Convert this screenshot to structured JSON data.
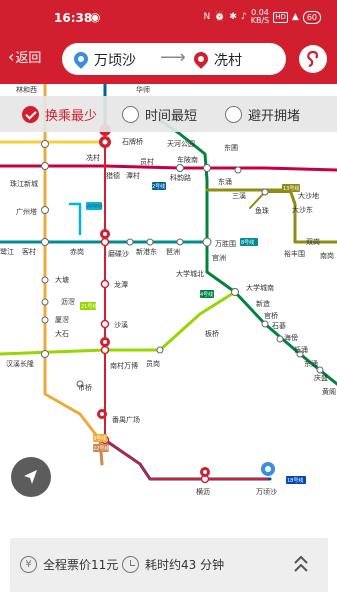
{
  "status_bar": {
    "time": "16:38",
    "network_speed": "0.04",
    "network_unit": "KB/S",
    "hd": "HD",
    "battery": "60"
  },
  "header": {
    "back_label": "返回",
    "from_station": "万顷沙",
    "to_station": "冼村",
    "app_logo_icon": "guangzhou-metro-logo",
    "accent_color": "#d21f2f"
  },
  "route_options": [
    {
      "label": "换乘最少",
      "selected": true
    },
    {
      "label": "时间最短",
      "selected": false
    },
    {
      "label": "避开拥堵",
      "selected": false
    }
  ],
  "map": {
    "stations": {
      "lin_he_xi": "林和西",
      "hua_lin": "华师",
      "shi_pai_qiao": "石牌桥",
      "tian_he_gong_yuan": "天河公园",
      "dong_pu": "东圃",
      "yuan_cun": "员村",
      "che_bei_nan": "车陂南",
      "xian_cun": "冼村",
      "lie_de": "猎德",
      "tan_cun": "潭村",
      "ke_yun_lu": "科韵路",
      "zhu_jiang_xin_cheng": "珠江新城",
      "dong_huan": "东涌",
      "san_xi": "三溪",
      "yu_zhu": "鱼珠",
      "da_sha_di": "大沙地",
      "da_sha_dong": "大沙东",
      "guang_zhou_ta": "广州塔",
      "ke_cun": "客村",
      "chi_gang": "赤岗",
      "mo_die_sha": "磨碟沙",
      "xin_gang_dong": "新港东",
      "pa_zhou": "琶洲",
      "wan_sheng_wei": "万胜围",
      "guan_zhou": "官洲",
      "lu_jiang": "鹭江",
      "da_tang": "大塘",
      "li_jiao": "沥滘",
      "xia_jiao": "厦滘",
      "da_shi": "大石",
      "long_tan": "龙潭",
      "sha_xi": "沙溪",
      "han_xi_chang_long": "汉溪长隆",
      "nan_cun_wan_bo": "南村万博",
      "yuan_gang": "员岗",
      "ban_qiao": "板桥",
      "da_xue_cheng_bei": "大学城北",
      "da_xue_cheng_nan": "大学城南",
      "xin_zao": "新造",
      "shi_qiao": "市桥",
      "fan_yu_guang_chang": "番禺广场",
      "heng_li": "横沥",
      "wan_qing_sha": "万顷沙",
      "shi_bi": "石碁",
      "hai_bang": "海傍",
      "di_yong": "低涌",
      "dong_chong": "东涌",
      "qing_sheng": "庆盛",
      "huang_ge": "黄阁",
      "gong_qiao": "官桥",
      "yu_feng_wei": "裕丰围",
      "shuang_gang": "双岗",
      "nan_gang": "南岗"
    },
    "line_badges": [
      "APM线",
      "2号线",
      "3号线",
      "4号线",
      "8号线",
      "13号线",
      "18号线",
      "21号线",
      "22号线",
      "7号线"
    ],
    "route_color": "#d21f2f",
    "line_colors": {
      "line1": "#f3d03e",
      "line2": "#00629b",
      "line3": "#ecaa3a",
      "line4": "#00843d",
      "line5": "#c5003e",
      "line7": "#97d700",
      "line8": "#008c95",
      "line13": "#8e8c13",
      "line18": "#0047ba",
      "line22": "#d0864f",
      "line21": "#201747",
      "apm": "#00b5e2"
    }
  },
  "summary": {
    "fare_text": "全程票价11元",
    "time_text": "耗时约43 分钟",
    "fare_icon": "yen-icon",
    "clock_icon": "clock-icon",
    "expand_icon": "double-chevron-up-icon"
  }
}
